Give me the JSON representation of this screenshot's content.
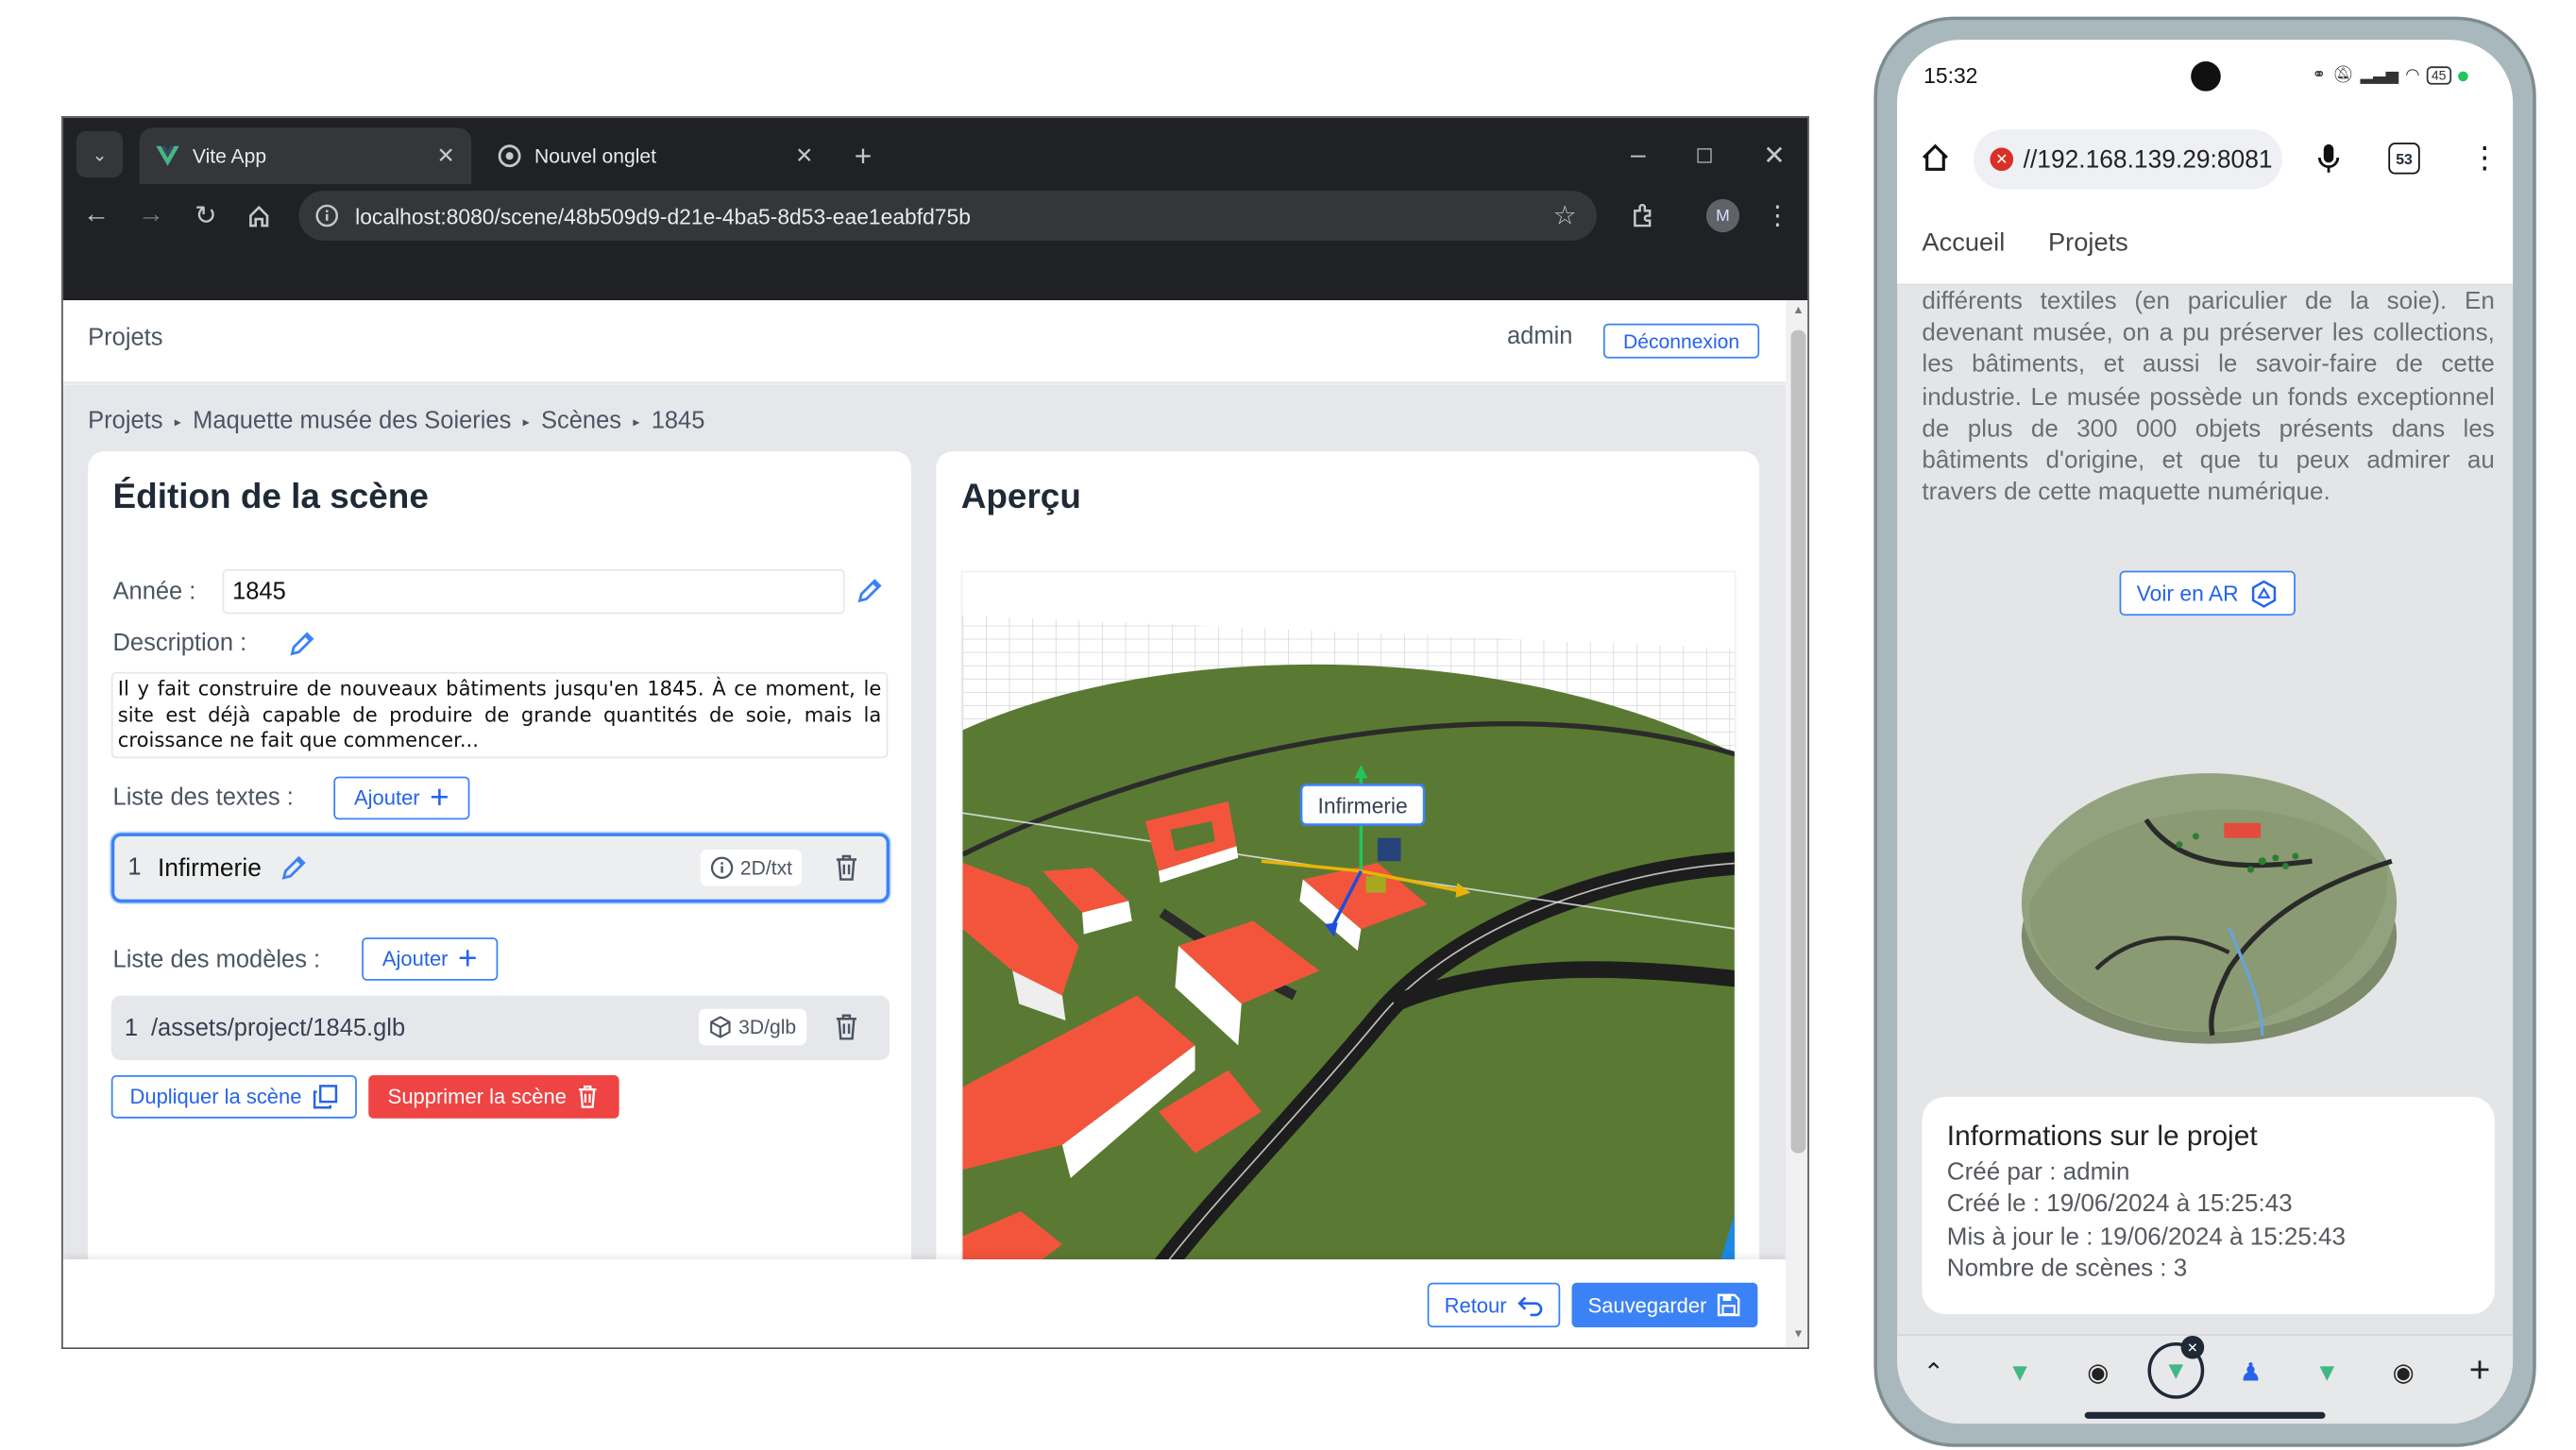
{
  "browser": {
    "tabs": [
      {
        "title": "Vite App",
        "active": true
      },
      {
        "title": "Nouvel onglet",
        "active": false
      }
    ],
    "url": "localhost:8080/scene/48b509d9-d21e-4ba5-8d53-eae1eabfd75b",
    "profile_initial": "M"
  },
  "app": {
    "nav_projects": "Projets",
    "user": "admin",
    "logout_label": "Déconnexion",
    "breadcrumb": [
      "Projets",
      "Maquette musée des Soieries",
      "Scènes",
      "1845"
    ],
    "edit_card": {
      "title": "Édition de la scène",
      "year_label": "Année :",
      "year_value": "1845",
      "description_label": "Description :",
      "description_value": "Il y fait construire de nouveaux bâtiments jusqu'en 1845. À ce moment, le site est déjà capable de produire de grande quantités de soie, mais la croissance ne fait que commencer...",
      "texts_label": "Liste des textes :",
      "add_label": "Ajouter",
      "texts": [
        {
          "index": "1",
          "value": "Infirmerie",
          "type": "2D/txt"
        }
      ],
      "models_label": "Liste des modèles :",
      "models": [
        {
          "index": "1",
          "path": "/assets/project/1845.glb",
          "type": "3D/glb"
        }
      ],
      "duplicate_label": "Dupliquer la scène",
      "delete_label": "Supprimer la scène"
    },
    "preview_card": {
      "title": "Aperçu",
      "label_3d": "Infirmerie"
    },
    "back_label": "Retour",
    "save_label": "Sauvegarder"
  },
  "phone": {
    "time": "15:32",
    "battery": "45",
    "url": "//192.168.139.29:8081",
    "tab_count": "53",
    "nav": [
      "Accueil",
      "Projets"
    ],
    "description": "différents textiles (en pariculier de la soie). En devenant musée, on a pu préserver les collections, les bâtiments, et aussi le savoir-faire de cette industrie. Le musée possède un fonds exceptionnel de plus de 300 000 objets présents dans les bâtiments d'origine, et que tu peux admirer au travers de cette maquette numérique.",
    "ar_label": "Voir en AR",
    "info": {
      "title": "Informations sur le projet",
      "created_by": "Créé par : admin",
      "created_at": "Créé le : 19/06/2024 à 15:25:43",
      "updated_at": "Mis à jour le : 19/06/2024 à 15:25:43",
      "scene_count": "Nombre de scènes : 3"
    }
  },
  "colors": {
    "primary": "#3b82f6",
    "danger": "#ef4444",
    "ground": "#5a7a33",
    "building": "#f2553b"
  }
}
